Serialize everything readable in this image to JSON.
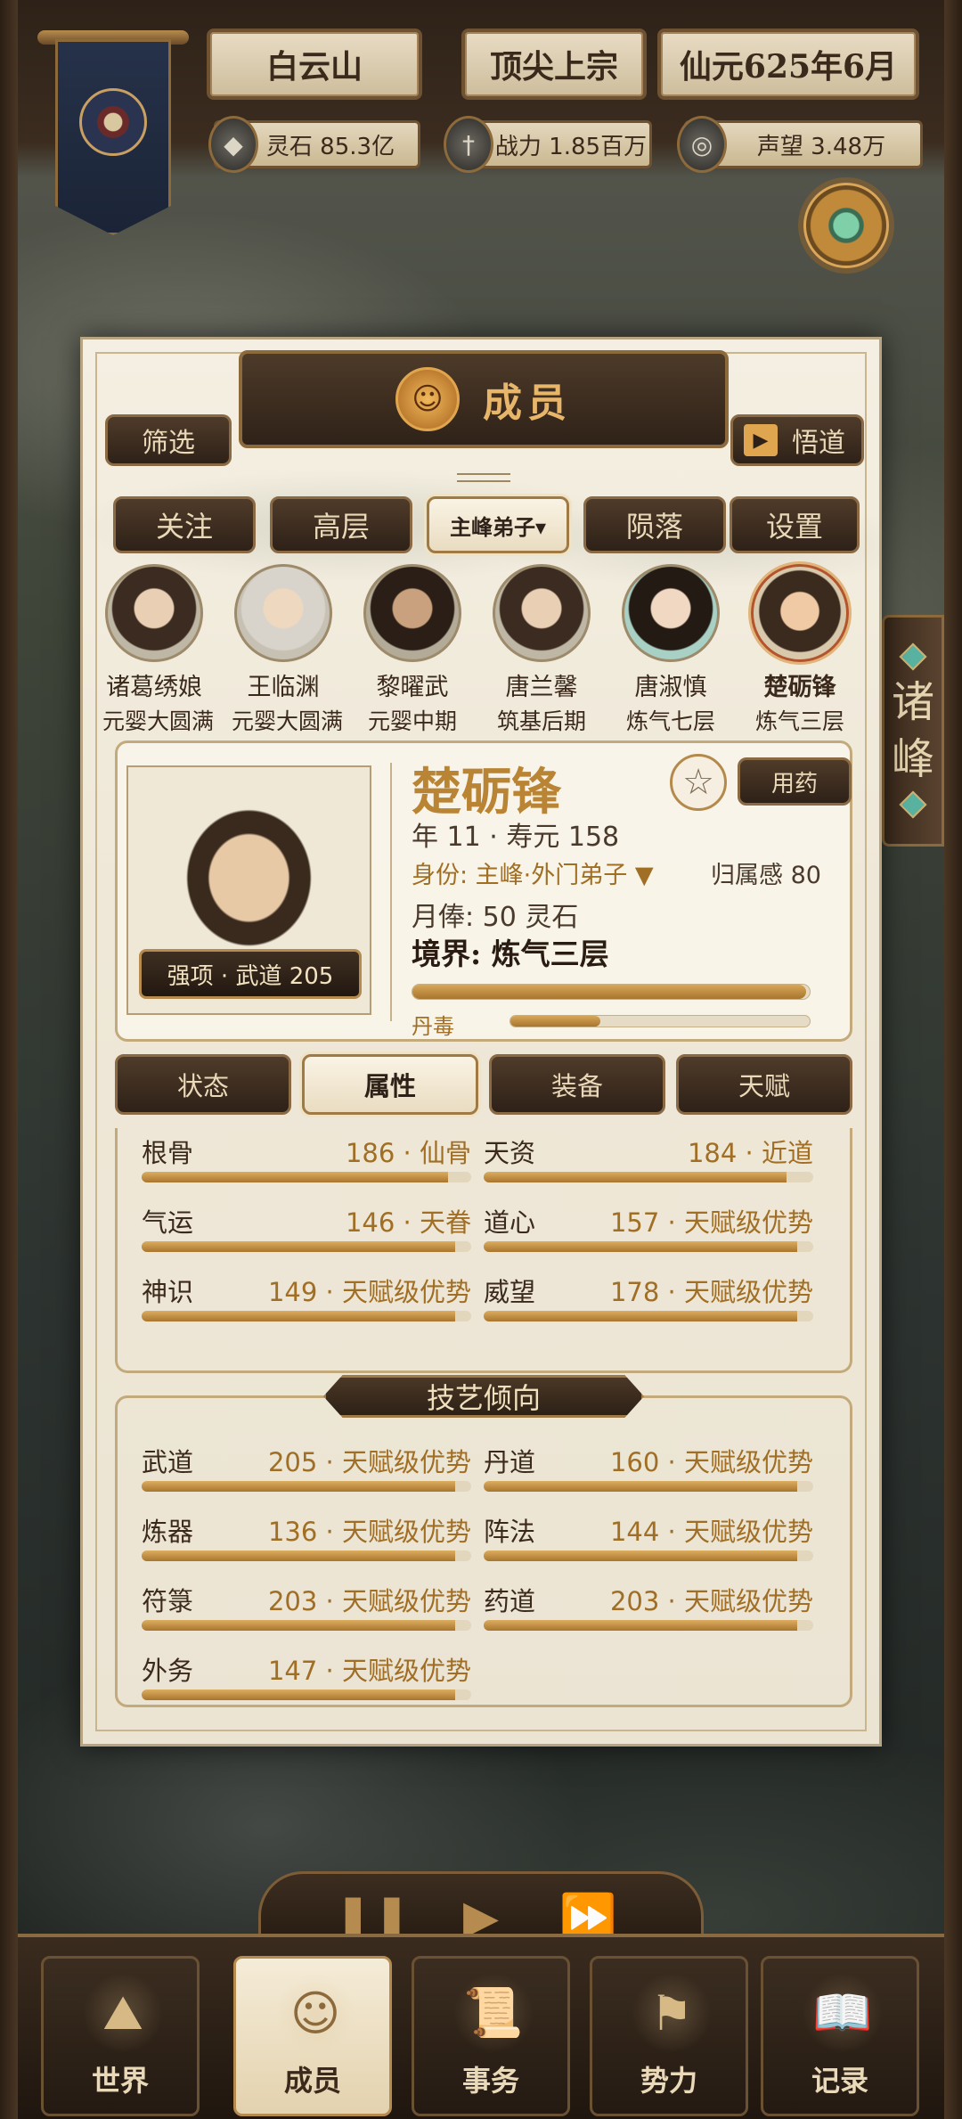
{
  "header": {
    "location": "白云山",
    "sect_rank": "顶尖上宗",
    "date": "仙元625年6月",
    "spirit_stones": "灵石 85.3亿",
    "combat_power": "战力 1.85百万",
    "reputation": "声望 3.48万"
  },
  "side_tab": {
    "char1": "诸",
    "char2": "峰"
  },
  "panel": {
    "title": "成员",
    "filter_label": "筛选",
    "enlighten_label": "悟道",
    "tabs": [
      "关注",
      "高层",
      "主峰弟子▾",
      "陨落",
      "设置"
    ]
  },
  "members": [
    {
      "name": "诸葛绣娘",
      "realm": "元婴大圆满"
    },
    {
      "name": "王临渊",
      "realm": "元婴大圆满"
    },
    {
      "name": "黎曜武",
      "realm": "元婴中期"
    },
    {
      "name": "唐兰馨",
      "realm": "筑基后期"
    },
    {
      "name": "唐淑慎",
      "realm": "炼气七层"
    },
    {
      "name": "楚砺锋",
      "realm": "炼气三层"
    }
  ],
  "detail": {
    "name": "楚砺锋",
    "strength": "强项 · 武道 205",
    "age_life": "年 11 · 寿元 158",
    "identity": "身份: 主峰·外门弟子 ▼",
    "belonging": "归属感 80",
    "salary": "月俸: 50 灵石",
    "realm": "境界: 炼气三层",
    "medicine_label": "用药",
    "poison_label": "丹毒",
    "progress": 0.99,
    "poison": 0.3
  },
  "detail_tabs": [
    "状态",
    "属性",
    "装备",
    "天赋"
  ],
  "attributes": [
    {
      "label": "根骨",
      "value": "186 · 仙骨",
      "fill": 0.93
    },
    {
      "label": "天资",
      "value": "184 · 近道",
      "fill": 0.92
    },
    {
      "label": "气运",
      "value": "146 · 天眷",
      "fill": 0.95
    },
    {
      "label": "道心",
      "value": "157 · 天赋级优势",
      "fill": 0.95
    },
    {
      "label": "神识",
      "value": "149 · 天赋级优势",
      "fill": 0.95
    },
    {
      "label": "威望",
      "value": "178 · 天赋级优势",
      "fill": 0.95
    }
  ],
  "skills_title": "技艺倾向",
  "skills": [
    {
      "label": "武道",
      "value": "205 · 天赋级优势",
      "fill": 0.95
    },
    {
      "label": "丹道",
      "value": "160 · 天赋级优势",
      "fill": 0.95
    },
    {
      "label": "炼器",
      "value": "136 · 天赋级优势",
      "fill": 0.95
    },
    {
      "label": "阵法",
      "value": "144 · 天赋级优势",
      "fill": 0.95
    },
    {
      "label": "符箓",
      "value": "203 · 天赋级优势",
      "fill": 0.95
    },
    {
      "label": "药道",
      "value": "203 · 天赋级优势",
      "fill": 0.95
    },
    {
      "label": "外务",
      "value": "147 · 天赋级优势",
      "fill": 0.95
    }
  ],
  "nav": [
    "世界",
    "成员",
    "事务",
    "势力",
    "记录"
  ],
  "colors": {
    "gold": "#a06e24",
    "dark_wood": "#2e2118",
    "paper": "#f4efe2"
  }
}
